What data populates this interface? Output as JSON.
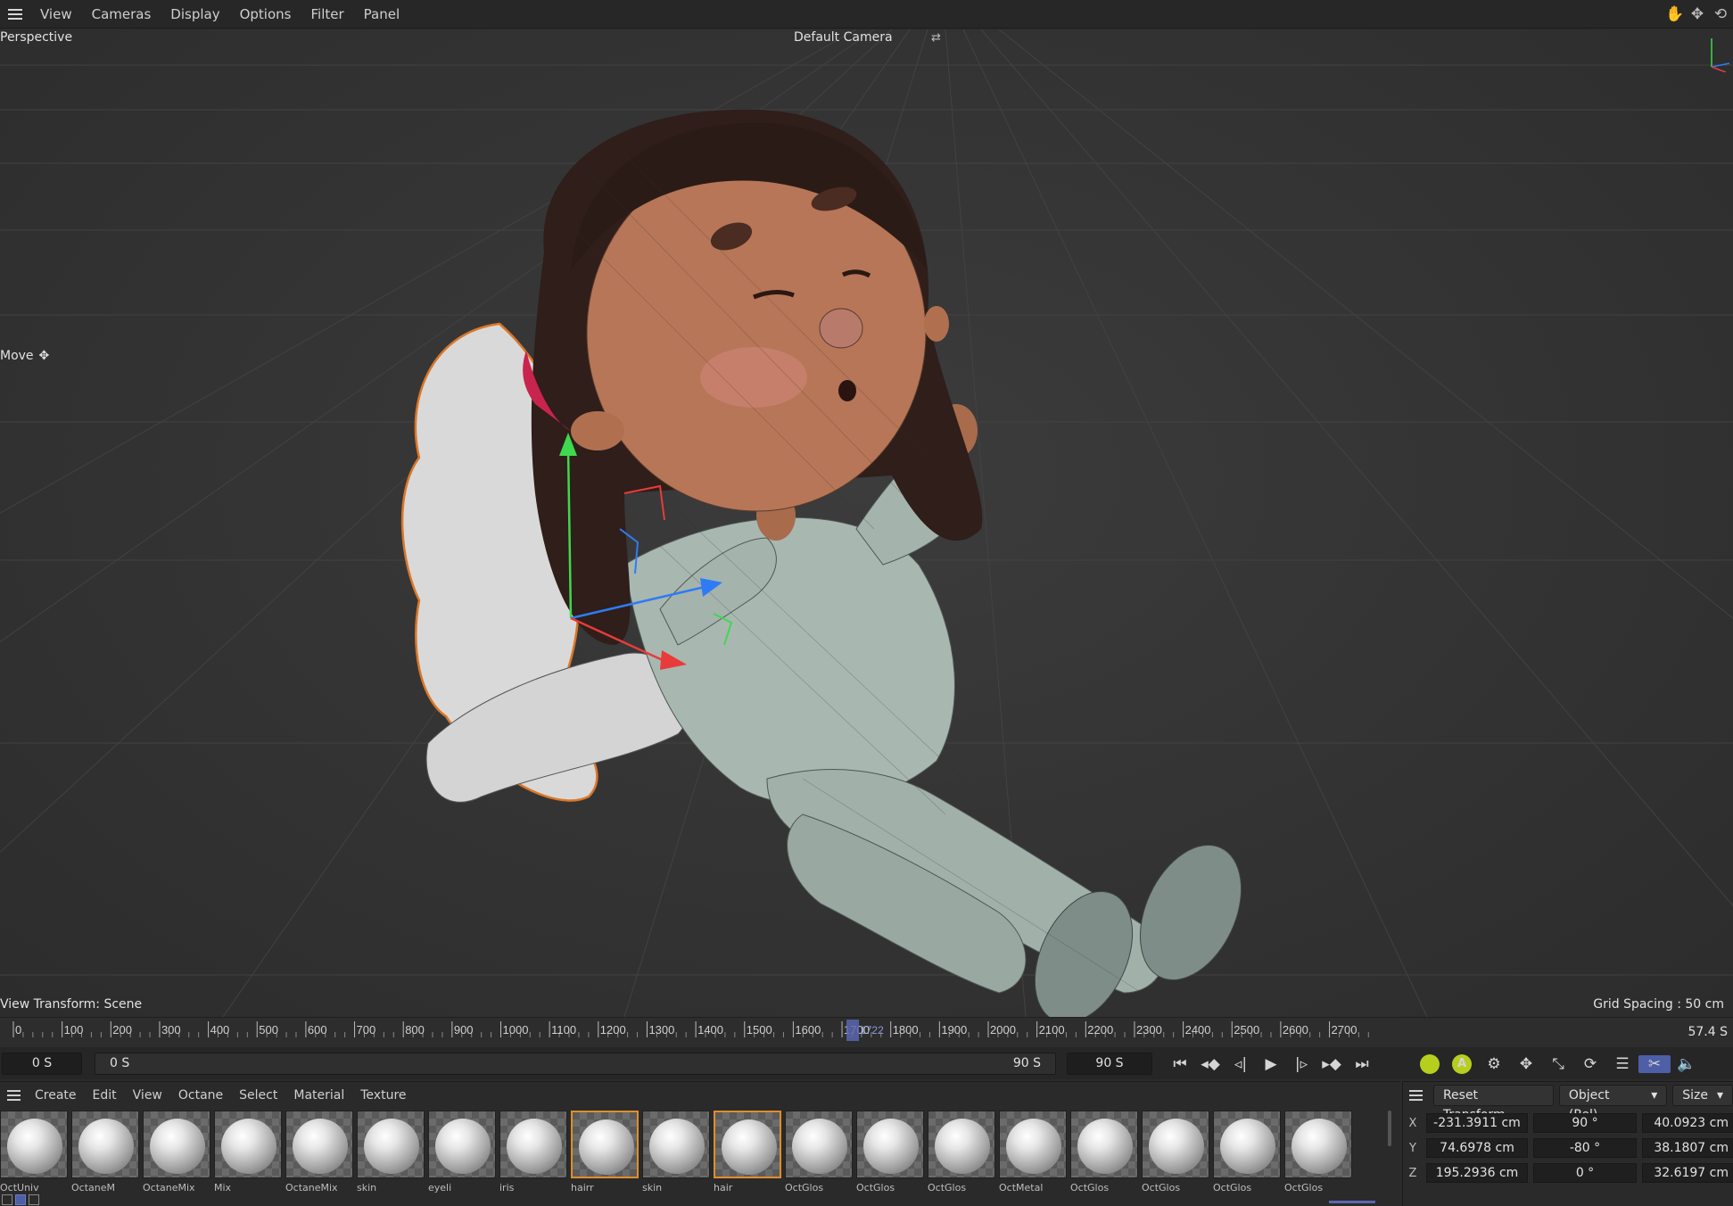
{
  "menubar": {
    "items": [
      "View",
      "Cameras",
      "Display",
      "Options",
      "Filter",
      "Panel"
    ]
  },
  "viewport": {
    "projection": "Perspective",
    "camera": "Default Camera",
    "tool": "Move",
    "view_transform": "View Transform: Scene",
    "grid_spacing": "Grid Spacing : 50 cm"
  },
  "timeline": {
    "ticks": [
      "0",
      "100",
      "200",
      "300",
      "400",
      "500",
      "600",
      "700",
      "800",
      "900",
      "1000",
      "1100",
      "1200",
      "1300",
      "1400",
      "1500",
      "1600",
      "1700",
      "1800",
      "1900",
      "2000",
      "2100",
      "2200",
      "2300",
      "2400",
      "2500",
      "2600",
      "2700"
    ],
    "current_frame": "1722",
    "current_time": "57.4 S",
    "start": "0 S",
    "range_start": "0 S",
    "range_end": "90 S",
    "end": "90 S"
  },
  "materials": {
    "menu": [
      "Create",
      "Edit",
      "View",
      "Octane",
      "Select",
      "Material",
      "Texture"
    ],
    "count": 19,
    "selected_indices": [
      8,
      10
    ],
    "names": [
      "OctUniv",
      "OctaneM",
      "OctaneMix",
      "Mix",
      "OctaneMix",
      "skin",
      "eyeli",
      "iris",
      "hairr",
      "skin",
      "hair",
      "OctGlos",
      "OctGlos",
      "OctGlos",
      "OctMetal",
      "OctGlos",
      "OctGlos",
      "OctGlos",
      "OctGlos"
    ]
  },
  "coords": {
    "reset_label": "Reset Transform",
    "mode": "Object (Rel)",
    "size_mode": "Size",
    "rows": [
      {
        "axis": "X",
        "pos": "-231.3911 cm",
        "rot": "90 °",
        "size": "40.0923 cm"
      },
      {
        "axis": "Y",
        "pos": "74.6978 cm",
        "rot": "-80 °",
        "size": "38.1807 cm"
      },
      {
        "axis": "Z",
        "pos": "195.2936 cm",
        "rot": "0 °",
        "size": "32.6197 cm"
      }
    ]
  },
  "colors": {
    "accent": "#4e5ea7",
    "selection": "#e18d2a",
    "record": "#b6cf1e"
  }
}
